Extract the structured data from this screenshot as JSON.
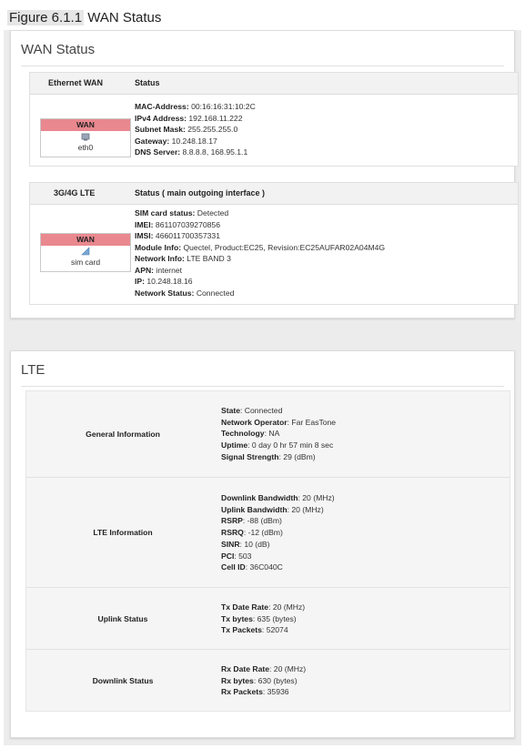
{
  "caption": {
    "figure": "Figure 6.1.1",
    "title": "WAN Status"
  },
  "wan_panel": {
    "title": "WAN Status",
    "ethernet": {
      "header_left": "Ethernet WAN",
      "header_right": "Status",
      "iface_label": "WAN",
      "iface_icon": "ethernet-port-icon",
      "iface_name": "eth0",
      "fields": [
        {
          "label": "MAC-Address:",
          "value": "00:16:16:31:10:2C"
        },
        {
          "label": "IPv4 Address:",
          "value": "192.168.11.222"
        },
        {
          "label": "Subnet Mask:",
          "value": "255.255.255.0"
        },
        {
          "label": "Gateway:",
          "value": "10.248.18.17"
        },
        {
          "label": "DNS Server:",
          "value": "8.8.8.8, 168.95.1.1"
        }
      ]
    },
    "lte": {
      "header_left": "3G/4G LTE",
      "header_right": "Status ( main outgoing interface )",
      "iface_label": "WAN",
      "iface_icon": "signal-icon",
      "iface_name": "sim card",
      "fields": [
        {
          "label": "SIM card status:",
          "value": "Detected"
        },
        {
          "label": "IMEI:",
          "value": "861107039270856"
        },
        {
          "label": "IMSI:",
          "value": "466011700357331"
        },
        {
          "label": "Module Info:",
          "value": "Quectel, Product:EC25, Revision:EC25AUFAR02A04M4G"
        },
        {
          "label": "Network Info:",
          "value": "LTE BAND 3"
        },
        {
          "label": "APN:",
          "value": "internet"
        },
        {
          "label": "IP:",
          "value": "10.248.18.16"
        },
        {
          "label": "Network Status:",
          "value": "Connected"
        }
      ]
    }
  },
  "lte_panel": {
    "title": "LTE",
    "rows": [
      {
        "name": "General Information",
        "fields": [
          {
            "label": "State",
            "value": ": Connected"
          },
          {
            "label": "Network Operator",
            "value": ": Far EasTone"
          },
          {
            "label": "Technology",
            "value": ": NA"
          },
          {
            "label": "Uptime",
            "value": ": 0 day 0 hr 57 min 8 sec"
          },
          {
            "label": "Signal Strength",
            "value": ": 29 (dBm)"
          }
        ]
      },
      {
        "name": "LTE Information",
        "fields": [
          {
            "label": "Downlink Bandwidth",
            "value": ": 20 (MHz)"
          },
          {
            "label": "Uplink Bandwidth",
            "value": ": 20 (MHz)"
          },
          {
            "label": "RSRP",
            "value": ": -88 (dBm)"
          },
          {
            "label": "RSRQ",
            "value": ": -12 (dBm)"
          },
          {
            "label": "SINR",
            "value": ": 10 (dB)"
          },
          {
            "label": "PCI",
            "value": ": 503"
          },
          {
            "label": "Cell ID",
            "value": ": 36C040C"
          }
        ]
      },
      {
        "name": "Uplink Status",
        "fields": [
          {
            "label": "Tx Date Rate",
            "value": ": 20 (MHz)"
          },
          {
            "label": "Tx bytes",
            "value": ": 635 (bytes)"
          },
          {
            "label": "Tx Packets",
            "value": ": 52074"
          }
        ]
      },
      {
        "name": "Downlink Status",
        "fields": [
          {
            "label": "Rx Date Rate",
            "value": ": 20 (MHz)"
          },
          {
            "label": "Rx bytes",
            "value": ": 630 (bytes)"
          },
          {
            "label": "Rx Packets",
            "value": ": 35936"
          }
        ]
      }
    ]
  },
  "colors": {
    "wan_badge": "#e9888f",
    "page_bg": "#ececec",
    "header_bg": "#f2f2f2"
  }
}
